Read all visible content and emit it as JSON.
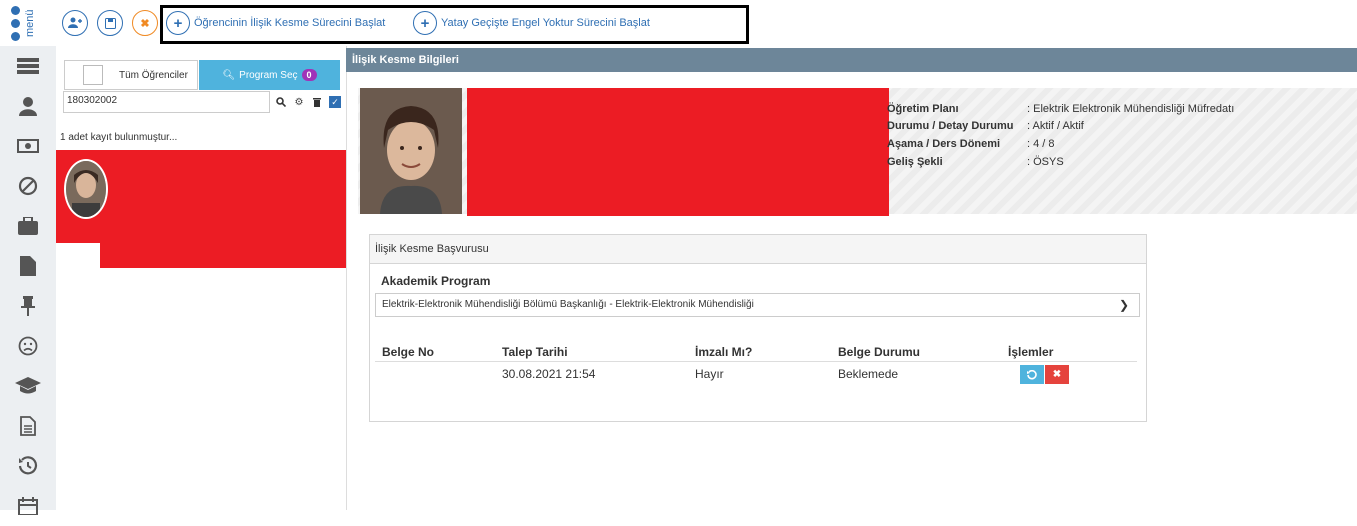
{
  "topbar": {
    "menu_label": "menü",
    "actions": [
      {
        "label": "Öğrencinin İlişik Kesme Sürecini Başlat",
        "icon": "plus-icon"
      },
      {
        "label": "Yatay Geçişte Engel Yoktur Sürecini Başlat",
        "icon": "plus-icon"
      }
    ],
    "icon_buttons": [
      "add-user-icon",
      "save-icon",
      "close-icon"
    ]
  },
  "sidebar_icons": [
    "list-icon",
    "user-icon",
    "money-icon",
    "ban-icon",
    "briefcase-icon",
    "file-icon",
    "pin-icon",
    "sad-face-icon",
    "graduation-cap-icon",
    "document-icon",
    "history-icon",
    "calendar-icon"
  ],
  "list_panel": {
    "tab_all": "Tüm Öğrenciler",
    "tab_program": "Program Seç",
    "program_count": "0",
    "search_value": "180302002",
    "result_text": "1 adet kayıt bulunmuştur..."
  },
  "main": {
    "header": "İlişik Kesme Bilgileri",
    "info": [
      {
        "key": "Öğretim Planı",
        "value": ": Elektrik Elektronik Mühendisliği Müfredatı"
      },
      {
        "key": "Durumu / Detay Durumu",
        "value": ": Aktif / Aktif"
      },
      {
        "key": "Aşama / Ders Dönemi",
        "value": ": 4 / 8"
      },
      {
        "key": "Geliş Şekli",
        "value": ": ÖSYS"
      }
    ],
    "panel": {
      "title": "İlişik Kesme Başvurusu",
      "program_label": "Akademik Program",
      "program_value": "Elektrik-Elektronik Mühendisliği Bölümü Başkanlığı - Elektrik-Elektronik Mühendisliği",
      "columns": [
        "Belge No",
        "Talep Tarihi",
        "İmzalı Mı?",
        "Belge Durumu",
        "İşlemler"
      ],
      "rows": [
        {
          "belge_no": "",
          "talep_tarihi": "30.08.2021 21:54",
          "imzali": "Hayır",
          "durum": "Beklemede"
        }
      ]
    }
  },
  "colors": {
    "accent": "#2f6fb3",
    "header": "#6d8699",
    "redaction": "#ec1c24",
    "tab_active": "#4fb3dd",
    "badge": "#a033b8"
  }
}
